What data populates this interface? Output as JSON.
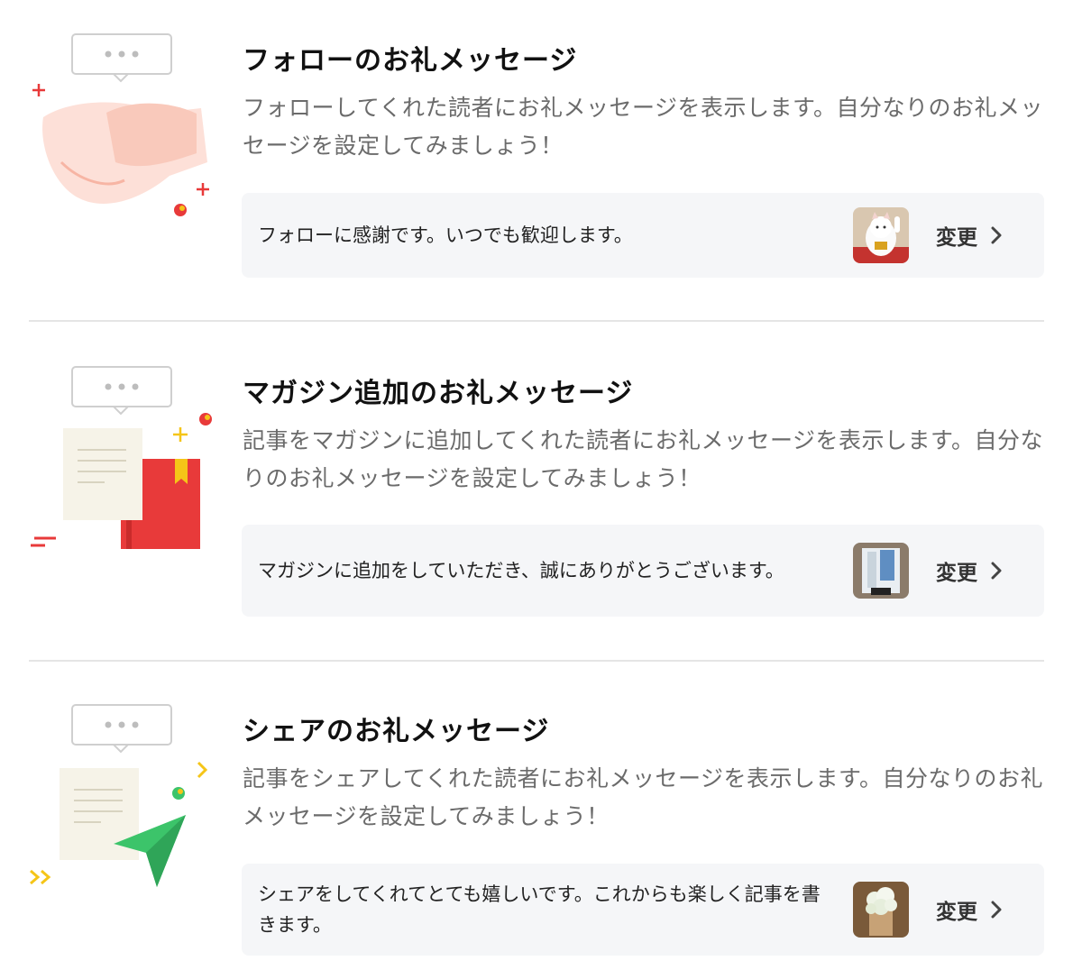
{
  "sections": [
    {
      "title": "フォローのお礼メッセージ",
      "description": "フォローしてくれた読者にお礼メッセージを表示します。自分なりのお礼メッセージを設定してみましょう！",
      "message": "フォローに感謝です。いつでも歓迎します。",
      "change_label": "変更",
      "illustration_icon": "handshake-icon",
      "thumbnail_icon": "lucky-cat-icon"
    },
    {
      "title": "マガジン追加のお礼メッセージ",
      "description": "記事をマガジンに追加してくれた読者にお礼メッセージを表示します。自分なりのお礼メッセージを設定してみましょう！",
      "message": "マガジンに追加をしていただき、誠にありがとうございます。",
      "change_label": "変更",
      "illustration_icon": "magazine-book-icon",
      "thumbnail_icon": "storage-case-icon"
    },
    {
      "title": "シェアのお礼メッセージ",
      "description": "記事をシェアしてくれた読者にお礼メッセージを表示します。自分なりのお礼メッセージを設定してみましょう！",
      "message": "シェアをしてくれてとても嬉しいです。これからも楽しく記事を書きます。",
      "change_label": "変更",
      "illustration_icon": "paper-plane-icon",
      "thumbnail_icon": "hydrangea-flower-icon"
    }
  ],
  "colors": {
    "title": "#111111",
    "description": "#6b6b6b",
    "card_background": "#f5f6f8",
    "divider": "#e5e5e5",
    "accent_red": "#e83a3a",
    "accent_yellow": "#f5c518",
    "accent_green": "#3cc46a"
  }
}
